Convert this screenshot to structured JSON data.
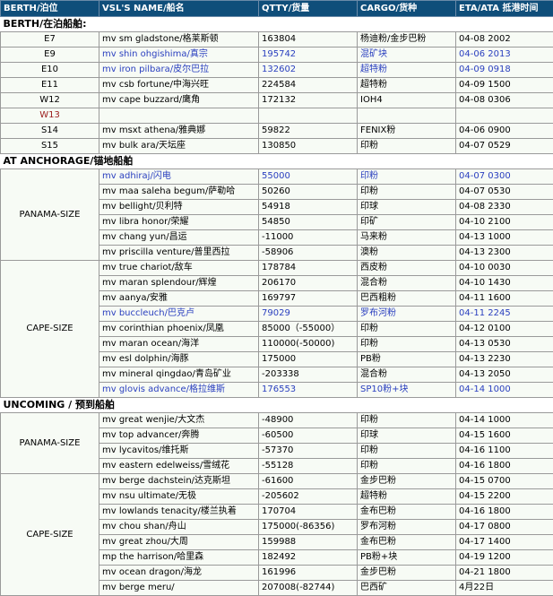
{
  "headers": {
    "berth": "BERTH/泊位",
    "vsl_name": "VSL'S NAME/船名",
    "qtty": "QTTY/货量",
    "cargo": "CARGO/货种",
    "eta": "ETA/ATA 抵港时间"
  },
  "sections": {
    "berth": "BERTH/在泊船舶:",
    "anchorage": "AT ANCHORAGE/锚地船舶",
    "upcoming": "UNCOMING / 预到船舶"
  },
  "groups": {
    "panama": "PANAMA-SIZE",
    "cape": "CAPE-SIZE",
    "panama2": "PANAMA-SIZE",
    "cape2": "CAPE-SIZE"
  },
  "berth_rows": [
    {
      "berth": "E7",
      "name": "mv sm gladstone/格莱斯顿",
      "qty": "163804",
      "cargo": "杨迪粉/金步巴粉",
      "eta": "04-08 2002"
    },
    {
      "berth": "E9",
      "name": "mv shin ohgishima/真宗",
      "qty": "195742",
      "cargo": "混矿块",
      "eta": "04-06 2013"
    },
    {
      "berth": "E10",
      "name": "mv iron pilbara/皮尔巴拉",
      "qty": "132602",
      "cargo": "超特粉",
      "eta": "04-09 0918"
    },
    {
      "berth": "E11",
      "name": "mv csb fortune/中海兴旺",
      "qty": "224584",
      "cargo": "超特粉",
      "eta": "04-09 1500"
    },
    {
      "berth": "W12",
      "name": "mv cape buzzard/鹰角",
      "qty": "172132",
      "cargo": "IOH4",
      "eta": "04-08 0306"
    },
    {
      "berth": "W13",
      "name": "",
      "qty": "",
      "cargo": "",
      "eta": ""
    },
    {
      "berth": "S14",
      "name": "mv msxt athena/雅典娜",
      "qty": "59822",
      "cargo": "FENIX粉",
      "eta": "04-06 0900"
    },
    {
      "berth": "S15",
      "name": "mv bulk ara/天坛座",
      "qty": "130850",
      "cargo": "印粉",
      "eta": "04-07 0529"
    }
  ],
  "anchorage_panama": [
    {
      "name": "mv adhiraj/闪电",
      "qty": "55000",
      "cargo": "印粉",
      "eta": "04-07 0300"
    },
    {
      "name": "mv maa saleha begum/萨勒哈",
      "qty": "50260",
      "cargo": "印粉",
      "eta": "04-07 0530"
    },
    {
      "name": "mv bellight/贝利特",
      "qty": "54918",
      "cargo": "印球",
      "eta": "04-08 2330"
    },
    {
      "name": "mv libra honor/荣耀",
      "qty": "54850",
      "cargo": "印矿",
      "eta": "04-10 2100"
    },
    {
      "name": "mv chang yun/昌运",
      "qty": "-11000",
      "cargo": "马来粉",
      "eta": "04-13 1000"
    },
    {
      "name": "mv priscilla venture/普里西拉",
      "qty": "-58906",
      "cargo": "澳粉",
      "eta": "04-13 2300"
    }
  ],
  "anchorage_cape": [
    {
      "name": "mv true chariot/敌车",
      "qty": "178784",
      "cargo": "西皮粉",
      "eta": "04-10 0030"
    },
    {
      "name": "mv maran splendour/辉煌",
      "qty": "206170",
      "cargo": "混合粉",
      "eta": "04-10 1430"
    },
    {
      "name": "mv aanya/安雅",
      "qty": "169797",
      "cargo": "巴西粗粉",
      "eta": "04-11 1600"
    },
    {
      "name": "mv buccleuch/巴克卢",
      "qty": "79029",
      "cargo": "罗布河粉",
      "eta": "04-11 2245"
    },
    {
      "name": "mv corinthian phoenix/凤凰",
      "qty": "85000（-55000）",
      "cargo": "印粉",
      "eta": "04-12 0100"
    },
    {
      "name": "mv maran ocean/海洋",
      "qty": "110000(-50000)",
      "cargo": "印粉",
      "eta": "04-13 0530"
    },
    {
      "name": "mv esl dolphin/海豚",
      "qty": "175000",
      "cargo": "PB粉",
      "eta": "04-13 2230"
    },
    {
      "name": "mv mineral qingdao/青岛矿业",
      "qty": "-203338",
      "cargo": "混合粉",
      "eta": "04-13 2050"
    },
    {
      "name": "mv glovis advance/格拉维斯",
      "qty": "176553",
      "cargo": "SP10粉+块",
      "eta": "04-14 1000"
    }
  ],
  "upcoming_panama": [
    {
      "name": "mv great wenjie/大文杰",
      "qty": "-48900",
      "cargo": "印粉",
      "eta": "04-14 1000"
    },
    {
      "name": "mv top advancer/奔腾",
      "qty": "-60500",
      "cargo": "印球",
      "eta": "04-15 1600"
    },
    {
      "name": "mv lycavitos/维托斯",
      "qty": "-57370",
      "cargo": "印粉",
      "eta": "04-16 1100"
    },
    {
      "name": "mv eastern edelweiss/雪绒花",
      "qty": "-55128",
      "cargo": "印粉",
      "eta": "04-16 1800"
    }
  ],
  "upcoming_cape": [
    {
      "name": "mv berge dachstein/达克斯坦",
      "qty": "-61600",
      "cargo": "金步巴粉",
      "eta": "04-15 0700"
    },
    {
      "name": "mv nsu ultimate/无极",
      "qty": "-205602",
      "cargo": "超特粉",
      "eta": "04-15 2200"
    },
    {
      "name": "mv lowlands tenacity/楼兰执着",
      "qty": "170704",
      "cargo": "金布巴粉",
      "eta": "04-16 1800"
    },
    {
      "name": "mv chou shan/舟山",
      "qty": "175000(-86356)",
      "cargo": "罗布河粉",
      "eta": "04-17 0800"
    },
    {
      "name": "mv great zhou/大周",
      "qty": "159988",
      "cargo": "金布巴粉",
      "eta": "04-17 1400"
    },
    {
      "name": "mp the harrison/哈里森",
      "qty": "182492",
      "cargo": "PB粉+块",
      "eta": "04-19 1200"
    },
    {
      "name": "mv ocean dragon/海龙",
      "qty": "161996",
      "cargo": "金步巴粉",
      "eta": "04-21 1800"
    },
    {
      "name": "mv berge meru/",
      "qty": "207008(-82744)",
      "cargo": "巴西矿",
      "eta": "4月22日"
    }
  ]
}
